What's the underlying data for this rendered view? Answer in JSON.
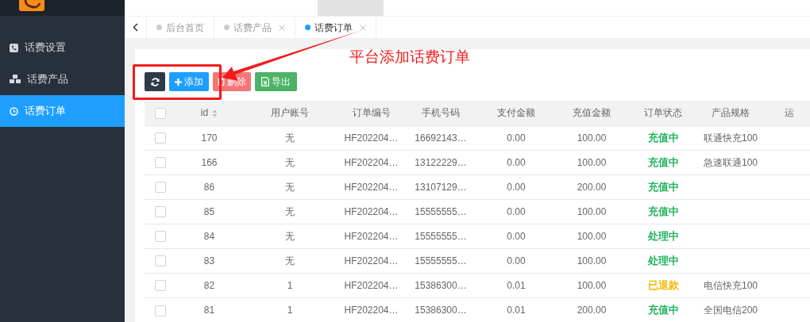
{
  "sidebar": {
    "items": [
      {
        "label": "话费设置",
        "selected": false
      },
      {
        "label": "话费产品",
        "selected": false
      },
      {
        "label": "话费订单",
        "selected": true
      }
    ]
  },
  "tabs": [
    {
      "label": "后台首页",
      "closable": false,
      "selected": false
    },
    {
      "label": "话费产品",
      "closable": true,
      "selected": false
    },
    {
      "label": "话费订单",
      "closable": true,
      "selected": true
    }
  ],
  "annotation": {
    "text": "平台添加话费订单"
  },
  "toolbar": [
    {
      "kind": "refresh"
    },
    {
      "kind": "add",
      "label": "添加"
    },
    {
      "kind": "delete",
      "label": "删除"
    },
    {
      "kind": "export",
      "label": "导出"
    }
  ],
  "table": {
    "all_checked": false,
    "columns": [
      "id",
      "用户账号",
      "订单编号",
      "手机号码",
      "支付金额",
      "充值金额",
      "订单状态",
      "产品规格",
      "运"
    ],
    "rows": [
      {
        "checked": false,
        "id": "170",
        "user": "无",
        "order": "HF202204…",
        "phone": "16692143…",
        "pay": "0.00",
        "charge": "100.00",
        "status": "充值中",
        "color": "#21b45c",
        "spec": "联通快充100"
      },
      {
        "checked": false,
        "id": "166",
        "user": "无",
        "order": "HF202204…",
        "phone": "13122229…",
        "pay": "0.00",
        "charge": "100.00",
        "status": "充值中",
        "color": "#21b45c",
        "spec": "急速联通100"
      },
      {
        "checked": false,
        "id": "86",
        "user": "无",
        "order": "HF202204…",
        "phone": "13107129…",
        "pay": "0.00",
        "charge": "200.00",
        "status": "充值中",
        "color": "#21b45c"
      },
      {
        "checked": false,
        "id": "85",
        "user": "无",
        "order": "HF202204…",
        "phone": "15555555…",
        "pay": "0.00",
        "charge": "100.00",
        "status": "充值中",
        "color": "#21b45c"
      },
      {
        "checked": false,
        "id": "84",
        "user": "无",
        "order": "HF202204…",
        "phone": "15555555…",
        "pay": "0.00",
        "charge": "100.00",
        "status": "处理中",
        "color": "#21b45c"
      },
      {
        "checked": false,
        "id": "83",
        "user": "无",
        "order": "HF202204…",
        "phone": "15555555…",
        "pay": "0.00",
        "charge": "100.00",
        "status": "处理中",
        "color": "#21b45c"
      },
      {
        "checked": false,
        "id": "82",
        "user": "1",
        "order": "HF202204…",
        "phone": "15386300…",
        "pay": "0.01",
        "charge": "100.00",
        "status": "已退款",
        "color": "#f5b800",
        "spec": "电信快充100"
      },
      {
        "checked": false,
        "id": "81",
        "user": "1",
        "order": "HF202204…",
        "phone": "15386300…",
        "pay": "0.01",
        "charge": "200.00",
        "status": "充值中",
        "color": "#21b45c",
        "spec": "全国电信200"
      }
    ]
  }
}
